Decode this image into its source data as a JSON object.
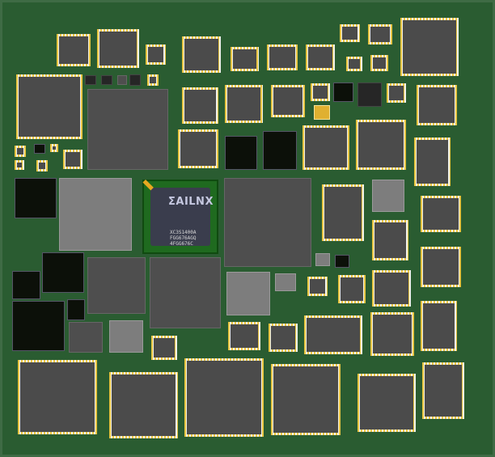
{
  "board": {
    "color": "#2a5c31",
    "pin_color": "#e9c542"
  },
  "fpga": {
    "logo": "ΣAILNX",
    "marking": [
      "XC3S1400A",
      "FGG676AGQ",
      "4FGG676C"
    ]
  }
}
